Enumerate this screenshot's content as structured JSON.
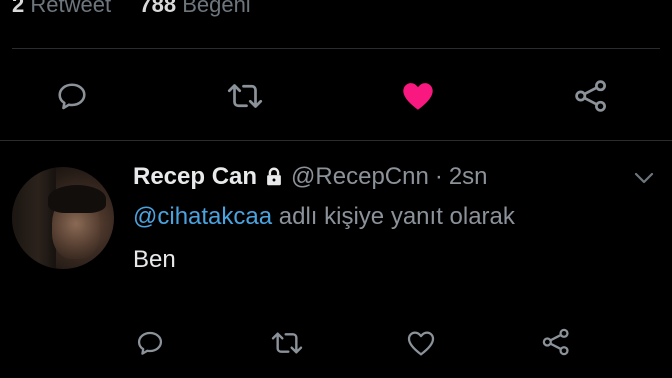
{
  "stats": {
    "retweet_count": "2",
    "retweet_label": "Retweet",
    "like_count": "788",
    "like_label": "Beğeni"
  },
  "main_actions": [
    {
      "icon": "reply-icon",
      "color": "#8b9299"
    },
    {
      "icon": "retweet-icon",
      "color": "#8b9299"
    },
    {
      "icon": "heart-filled-icon",
      "color": "#f91880"
    },
    {
      "icon": "share-icon",
      "color": "#8b9299"
    }
  ],
  "reply": {
    "display_name": "Recep Can",
    "handle": "@RecepCnn",
    "separator": "·",
    "time": "2sn",
    "mention": "@cihatakcaa",
    "reply_suffix": "adlı kişiye yanıt olarak",
    "text": "Ben"
  },
  "colors": {
    "background": "#000000",
    "text": "#e7e9ea",
    "muted": "#8b9299",
    "link": "#4aa3df",
    "like": "#f91880",
    "divider": "#2a2d30"
  }
}
